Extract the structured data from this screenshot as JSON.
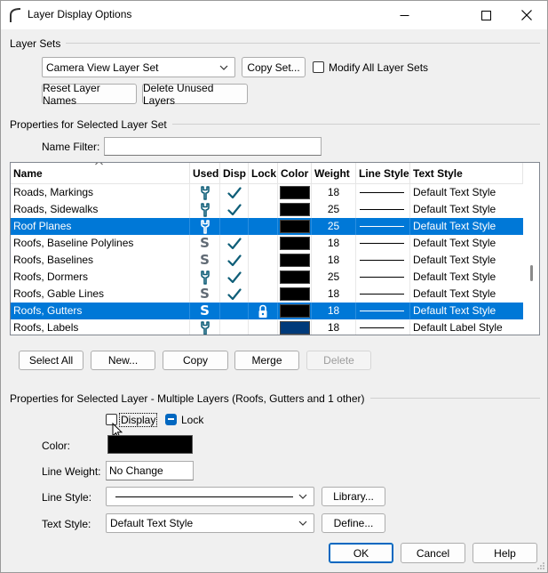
{
  "window": {
    "title": "Layer Display Options"
  },
  "layer_sets": {
    "group_label": "Layer Sets",
    "selected_set": "Camera View Layer Set",
    "copy_set_label": "Copy Set...",
    "modify_all_label": "Modify All Layer Sets",
    "reset_names_label": "Reset Layer Names",
    "delete_unused_label": "Delete Unused Layers"
  },
  "properties_set": {
    "group_label": "Properties for Selected Layer Set",
    "name_filter_label": "Name Filter:",
    "name_filter_value": ""
  },
  "table": {
    "columns": [
      "Name",
      "Used",
      "Disp",
      "Lock",
      "Color",
      "Weight",
      "Line Style",
      "Text Style"
    ],
    "rows": [
      {
        "name": "Roads, Markings",
        "used": "wrench",
        "disp": true,
        "lock": false,
        "color": "#000000",
        "weight": "18",
        "text_style": "Default Text Style",
        "selected": false
      },
      {
        "name": "Roads, Sidewalks",
        "used": "wrench",
        "disp": true,
        "lock": false,
        "color": "#000000",
        "weight": "25",
        "text_style": "Default Text Style",
        "selected": false
      },
      {
        "name": "Roof Planes",
        "used": "wrench",
        "disp": false,
        "lock": false,
        "color": "#000000",
        "weight": "25",
        "text_style": "Default Text Style",
        "selected": true
      },
      {
        "name": "Roofs, Baseline Polylines",
        "used": "S",
        "disp": true,
        "lock": false,
        "color": "#000000",
        "weight": "18",
        "text_style": "Default Text Style",
        "selected": false
      },
      {
        "name": "Roofs, Baselines",
        "used": "S",
        "disp": true,
        "lock": false,
        "color": "#000000",
        "weight": "18",
        "text_style": "Default Text Style",
        "selected": false
      },
      {
        "name": "Roofs, Dormers",
        "used": "wrench",
        "disp": true,
        "lock": false,
        "color": "#000000",
        "weight": "25",
        "text_style": "Default Text Style",
        "selected": false
      },
      {
        "name": "Roofs, Gable Lines",
        "used": "S",
        "disp": true,
        "lock": false,
        "color": "#000000",
        "weight": "18",
        "text_style": "Default Text Style",
        "selected": false
      },
      {
        "name": "Roofs, Gutters",
        "used": "S",
        "disp": false,
        "lock": true,
        "color": "#000000",
        "weight": "18",
        "text_style": "Default Text Style",
        "selected": true
      },
      {
        "name": "Roofs, Labels",
        "used": "wrench",
        "disp": false,
        "lock": false,
        "color": "#003a7a",
        "weight": "18",
        "text_style": "Default Label Style",
        "selected": false
      }
    ]
  },
  "table_buttons": {
    "select_all": "Select All",
    "new": "New...",
    "copy": "Copy",
    "merge": "Merge",
    "delete": "Delete"
  },
  "layer_props": {
    "group_label": "Properties for Selected Layer - Multiple Layers (Roofs, Gutters and 1 other)",
    "display_label": "Display",
    "lock_label": "Lock",
    "color_label": "Color:",
    "color_value": "#000000",
    "line_weight_label": "Line Weight:",
    "line_weight_value": "No Change",
    "line_style_label": "Line Style:",
    "library_label": "Library...",
    "text_style_label": "Text Style:",
    "text_style_value": "Default Text Style",
    "define_label": "Define..."
  },
  "footer": {
    "ok": "OK",
    "cancel": "Cancel",
    "help": "Help"
  },
  "colors": {
    "selection": "#0078d7",
    "accent": "#0067c0",
    "icon_teal": "#0f5e78"
  }
}
